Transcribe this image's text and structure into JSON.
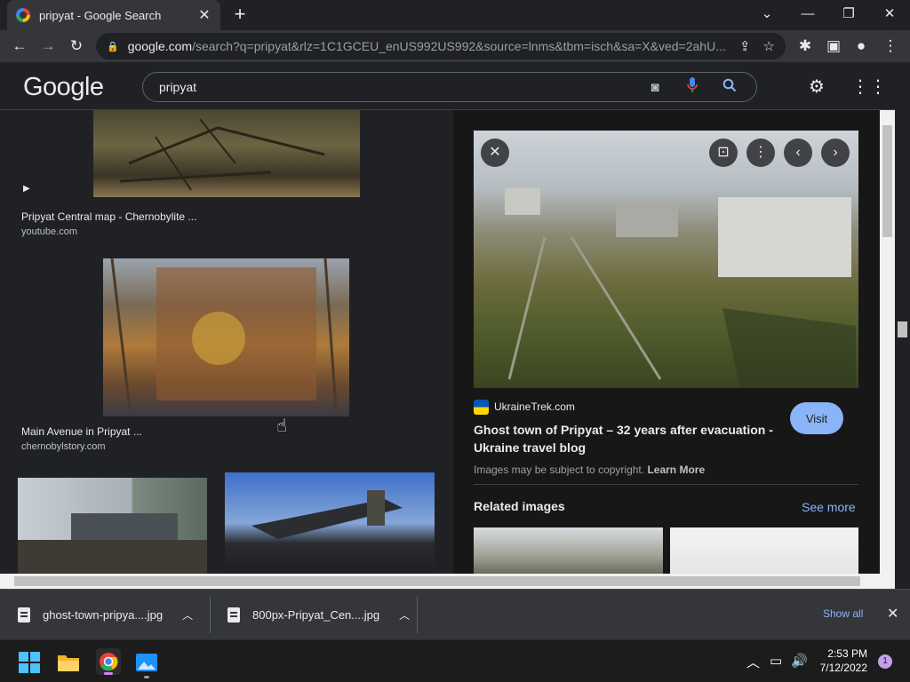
{
  "browser": {
    "tab_title": "pripyat - Google Search",
    "url_domain": "google.com",
    "url_path": "/search?q=pripyat&rlz=1C1GCEU_enUS992US992&source=lnms&tbm=isch&sa=X&ved=2ahU..."
  },
  "google": {
    "logo": "Google",
    "query": "pripyat"
  },
  "results": [
    {
      "caption": "Pripyat Central map - Chernobylite ...",
      "source": "youtube.com"
    },
    {
      "caption": "Main Avenue in Pripyat ...",
      "source": "chernobylstory.com"
    }
  ],
  "panel": {
    "source_name": "UkraineTrek.com",
    "title": "Ghost town of Pripyat – 32 years after evacuation - Ukraine travel blog",
    "visit_label": "Visit",
    "copyright": "Images may be subject to copyright.",
    "learn_more": "Learn More",
    "related_title": "Related images",
    "see_more": "See more"
  },
  "downloads": {
    "items": [
      {
        "name": "ghost-town-pripya....jpg"
      },
      {
        "name": "800px-Pripyat_Cen....jpg"
      }
    ],
    "show_all": "Show all"
  },
  "taskbar": {
    "time": "2:53 PM",
    "date": "7/12/2022",
    "notification_count": "1"
  },
  "colors": {
    "accent": "#8ab4f8",
    "background": "#202124",
    "panel": "#171717"
  }
}
